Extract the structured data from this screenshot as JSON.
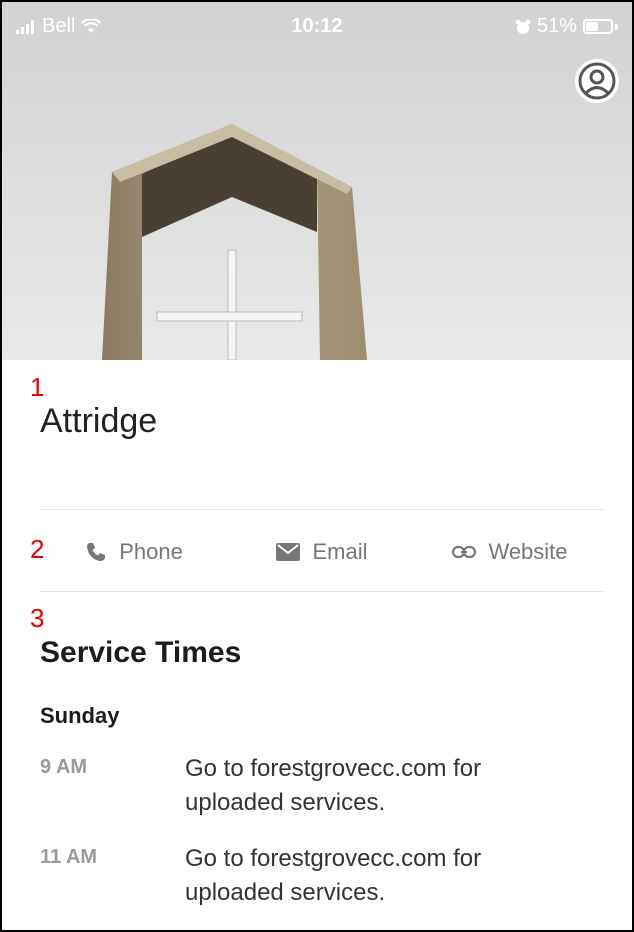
{
  "status_bar": {
    "carrier": "Bell",
    "time": "10:12",
    "battery_percent": "51%",
    "battery_level": 0.51
  },
  "hero": {
    "image_subject": "church-arch-cross-photo"
  },
  "markers": [
    "1",
    "2",
    "3"
  ],
  "church": {
    "name": "Attridge"
  },
  "actions": [
    {
      "label": "Phone",
      "icon": "phone-icon"
    },
    {
      "label": "Email",
      "icon": "email-icon"
    },
    {
      "label": "Website",
      "icon": "link-icon"
    }
  ],
  "service_times": {
    "title": "Service Times",
    "days": [
      {
        "day": "Sunday",
        "entries": [
          {
            "time": "9 AM",
            "description": "Go to forestgrovecc.com for uploaded services."
          },
          {
            "time": "11 AM",
            "description": "Go to forestgrovecc.com for uploaded services."
          }
        ]
      }
    ]
  },
  "colors": {
    "marker": "#e00000",
    "muted_text": "#777777",
    "time_text": "#9a9a9a"
  }
}
